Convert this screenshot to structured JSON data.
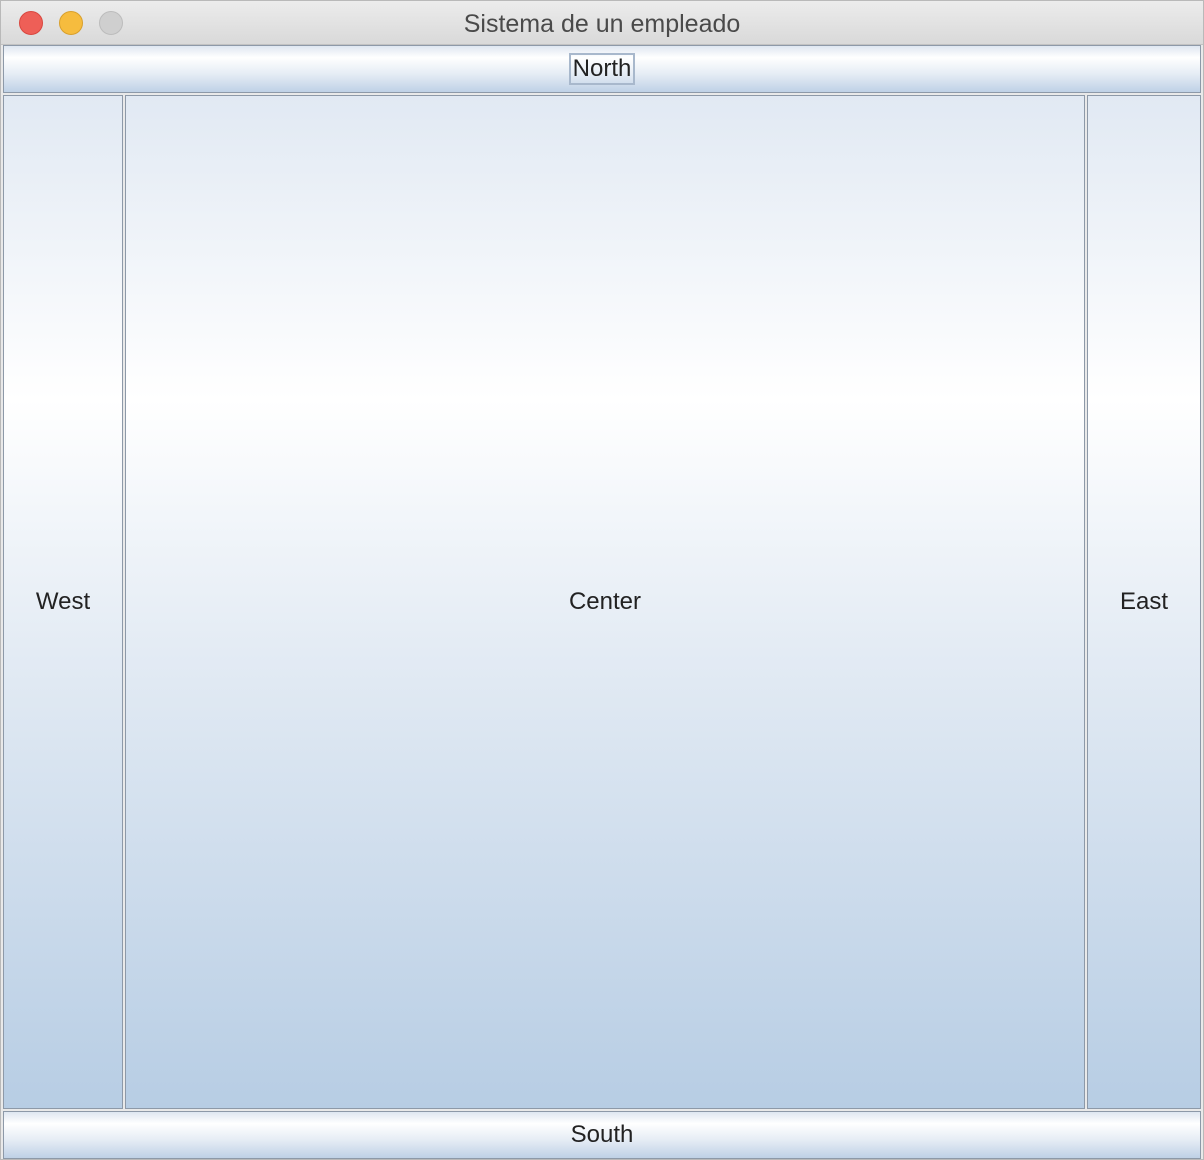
{
  "window": {
    "title": "Sistema de un empleado"
  },
  "buttons": {
    "north": "North",
    "west": "West",
    "center": "Center",
    "east": "East",
    "south": "South"
  },
  "colors": {
    "close": "#ee5f57",
    "minimize": "#f6bc3e",
    "zoom": "#cfcfcf",
    "button_top": "#e1e9f3",
    "button_bottom": "#b7cde4"
  }
}
